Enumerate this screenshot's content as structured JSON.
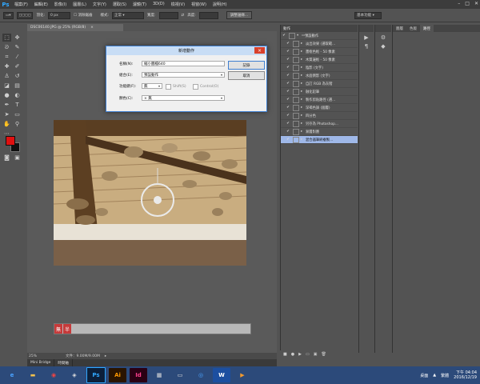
{
  "menu": {
    "app_logo": "Ps",
    "items": [
      "檔案(F)",
      "編輯(E)",
      "影像(I)",
      "圖層(L)",
      "文字(Y)",
      "選取(S)",
      "濾鏡(T)",
      "3D(D)",
      "檢視(V)",
      "視窗(W)",
      "說明(H)"
    ],
    "window_controls": [
      "–",
      "□",
      "✕"
    ]
  },
  "options_bar": {
    "feather_label": "羽化:",
    "feather_value": "0 px",
    "antialias_label": "消除鋸齒",
    "style_label": "樣式:",
    "style_value": "正常",
    "width_label": "寬度:",
    "height_label": "高度:",
    "refine_edge_button": "調整邊緣...",
    "workspace_value": "基本功能"
  },
  "document": {
    "tab_title": "DSC06140.JPG @ 25% (RGB/8)",
    "zoom": "25%",
    "doc_info": "文件：9.00M/9.00M"
  },
  "action_bar": {
    "tags": [
      "無",
      "半"
    ]
  },
  "bottom_tabs": [
    "Mini Bridge",
    "時間軸"
  ],
  "actions_panel": {
    "tab": "動作",
    "rows": [
      {
        "name": "預設動作",
        "folder": true,
        "selected": false
      },
      {
        "name": "淡出效果 (選取範...",
        "folder": false,
        "selected": false
      },
      {
        "name": "畫框色框 - 50 像素",
        "folder": false,
        "selected": false
      },
      {
        "name": "木質邊框 - 50 像素",
        "folder": false,
        "selected": false
      },
      {
        "name": "陰影 (文字)",
        "folder": false,
        "selected": false
      },
      {
        "name": "水面倒影 (文字)",
        "folder": false,
        "selected": false
      },
      {
        "name": "自訂 RGB 為灰階",
        "folder": false,
        "selected": false
      },
      {
        "name": "融化鉛筆",
        "folder": false,
        "selected": false
      },
      {
        "name": "製作剪貼路徑 (選...",
        "folder": false,
        "selected": false
      },
      {
        "name": "深褐色調 (圖層)",
        "folder": false,
        "selected": false
      },
      {
        "name": "四分色",
        "folder": false,
        "selected": false
      },
      {
        "name": "另存為 Photoshop...",
        "folder": false,
        "selected": false
      },
      {
        "name": "漸層對應",
        "folder": false,
        "selected": false
      },
      {
        "name": "混合器筆刷複製...",
        "folder": false,
        "selected": true
      }
    ],
    "footer_icons": [
      "■",
      "●",
      "▶",
      "▭",
      "▣",
      "🗑"
    ]
  },
  "right_panel": {
    "tabs": [
      "圖層",
      "色版",
      "路徑"
    ],
    "active_tab": "路徑"
  },
  "dialog": {
    "title": "新增動作",
    "name_label": "名稱(N):",
    "name_value": "縮小圖檔640",
    "set_label": "組合(E):",
    "set_value": "預設動作",
    "fkey_label": "功能鍵(F):",
    "fkey_value": "無",
    "shift_label": "Shift(S)",
    "control_label": "Control(O)",
    "color_label": "顏色(C):",
    "color_value": "× 無",
    "record_button": "記錄",
    "cancel_button": "取消"
  },
  "taskbar": {
    "tray_label": "桌面",
    "ime": "繁體",
    "time": "下午 04:04",
    "date": "2016/12/19"
  }
}
